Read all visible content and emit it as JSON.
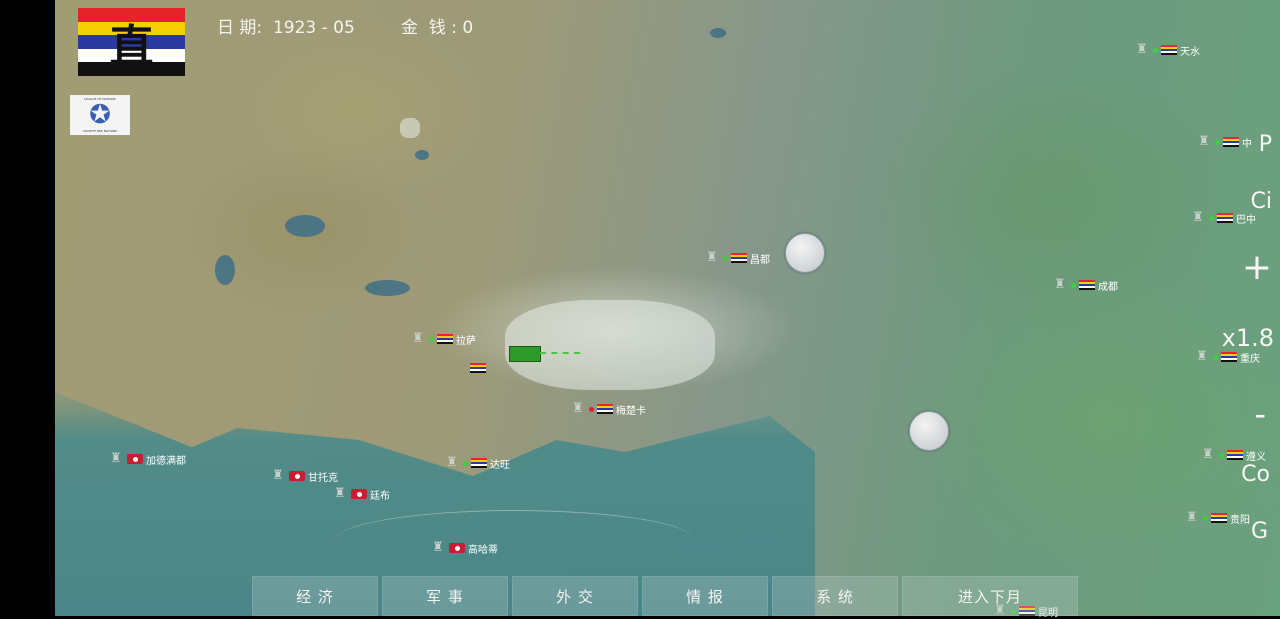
{
  "hud": {
    "faction_char": "直",
    "faction_flag_colors": [
      "#e3242b",
      "#f5d000",
      "#2a3aa0",
      "#ffffff",
      "#111111"
    ],
    "league_text_top": "LEAGUE OF NATIONS",
    "league_text_bottom": "SOCIETE DES NATIONS",
    "date_label": "日 期:  1923 - 05",
    "money_label": "金  钱 : 0"
  },
  "cities": [
    {
      "name": "天水",
      "flag": "zhili"
    },
    {
      "name": "中",
      "flag": "zhili"
    },
    {
      "name": "巴中",
      "flag": "zhili"
    },
    {
      "name": "昌都",
      "flag": "zhili"
    },
    {
      "name": "成都",
      "flag": "zhili"
    },
    {
      "name": "拉萨",
      "flag": "zhili"
    },
    {
      "name": "重庆",
      "flag": "zhili"
    },
    {
      "name": "梅楚卡",
      "flag": "zhili"
    },
    {
      "name": "遵义",
      "flag": "zhili"
    },
    {
      "name": "达旺",
      "flag": "zhili"
    },
    {
      "name": "加德满都",
      "flag": "nepal"
    },
    {
      "name": "甘托克",
      "flag": "nepal"
    },
    {
      "name": "廷布",
      "flag": "nepal"
    },
    {
      "name": "贵阳",
      "flag": "zhili"
    },
    {
      "name": "高哈蒂",
      "flag": "nepal"
    },
    {
      "name": "昆明",
      "flag": "zhili"
    }
  ],
  "side_controls": {
    "p_label": "P",
    "ci_label": "Ci",
    "zoom_in_label": "+",
    "zoom_level": "x1.8",
    "zoom_out_label": "-",
    "co_label": "Co",
    "g_label": "G"
  },
  "menu": [
    {
      "label": "经 济"
    },
    {
      "label": "军 事"
    },
    {
      "label": "外 交"
    },
    {
      "label": "情 报"
    },
    {
      "label": "系 统"
    },
    {
      "label": "进入下月"
    }
  ],
  "colors": {
    "army_unit": "#2f9a2c",
    "nepal_flag": "#c81e32"
  }
}
